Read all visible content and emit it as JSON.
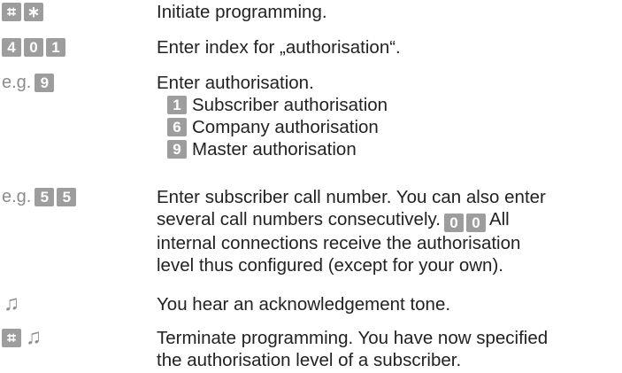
{
  "steps": [
    {
      "keys": [
        "⌗",
        "∗"
      ],
      "text": "Initiate programming."
    },
    {
      "keys": [
        "4",
        "0",
        "1"
      ],
      "text": "Enter index for „authorisation“."
    },
    {
      "prefix": "e.g.",
      "keys": [
        "9"
      ],
      "text": "Enter authorisation.",
      "options": [
        {
          "key": "1",
          "label": "Subscriber authorisation"
        },
        {
          "key": "6",
          "label": "Company authorisation"
        },
        {
          "key": "9",
          "label": "Master authorisation"
        }
      ]
    },
    {
      "prefix": "e.g.",
      "keys": [
        "5",
        "5"
      ],
      "text_line1": "Enter subscriber call number. You can also enter",
      "text_line2a": "several call numbers consecutively.",
      "inline_keys": [
        "0",
        "0"
      ],
      "text_line2b": "All",
      "text_line3": "internal connections receive the authorisation",
      "text_line4": "level thus configured (except for your own)."
    },
    {
      "icon": "music-note-icon",
      "text": "You hear an acknowledgement tone."
    },
    {
      "keys": [
        "⌗"
      ],
      "icon": "music-note-icon",
      "text_line1": "Terminate programming. You have now specified",
      "text_line2": "the authorisation level of a subscriber."
    }
  ],
  "tone_symbol": "♫",
  "colors": {
    "key_bg": "#9d9d9d",
    "key_fg": "#ffffff",
    "text": "#222222",
    "muted": "#8c8c8c"
  }
}
